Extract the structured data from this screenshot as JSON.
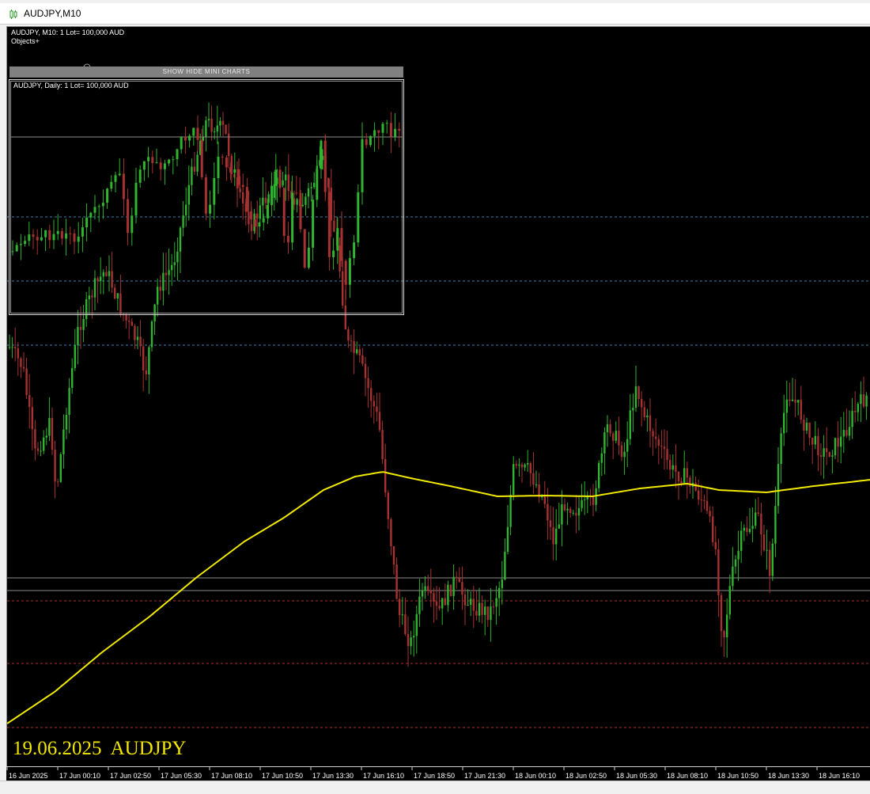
{
  "window": {
    "title": "AUDJPY,M10"
  },
  "main_chart": {
    "info_line": "AUDJPY, M10:  1 Lot= 100,000 AUD",
    "objects_line": "Objects+",
    "date_stamp": "19.06.2025  AUDJPY",
    "time_labels": [
      "16 Jun 2025",
      "17 Jun 00:10",
      "17 Jun 02:50",
      "17 Jun 05:30",
      "17 Jun 08:10",
      "17 Jun 10:50",
      "17 Jun 13:30",
      "17 Jun 16:10",
      "17 Jun 18:50",
      "17 Jun 21:30",
      "18 Jun 00:10",
      "18 Jun 02:50",
      "18 Jun 05:30",
      "18 Jun 08:10",
      "18 Jun 10:50",
      "18 Jun 13:30",
      "18 Jun 16:10"
    ],
    "colors": {
      "background": "#000000",
      "bull_candle": "#2fb52f",
      "bear_candle": "#a83232",
      "moving_average": "#f2ea00",
      "resistance_line": "#3a7fb0",
      "support_line": "#b03030",
      "level_line": "#8c8c8c"
    }
  },
  "mini_chart": {
    "toggle_label": "SHOW HIDE MINI CHARTS",
    "info_line": "AUDJPY, Daily:  1 Lot= 100,000 AUD"
  }
}
